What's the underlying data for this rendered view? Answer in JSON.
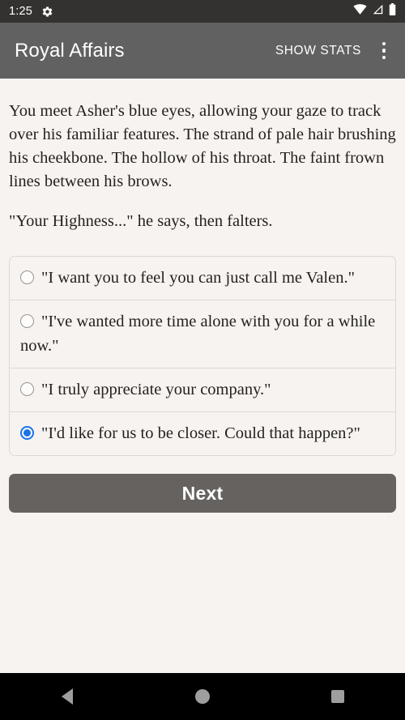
{
  "status_bar": {
    "clock": "1:25",
    "gear_icon": "gear-icon",
    "wifi_icon": "wifi-icon",
    "signal_icon": "cell-signal-icon",
    "battery_icon": "battery-full-icon"
  },
  "app_bar": {
    "title": "Royal Affairs",
    "action_label": "SHOW STATS",
    "overflow_icon": "more-vert-icon",
    "background_color": "#616161"
  },
  "story": {
    "paragraphs": [
      "You meet Asher's blue eyes, allowing your gaze to track over his familiar features. The strand of pale hair brushing his cheekbone. The hollow of his throat. The faint frown lines between his brows.",
      "\"Your Highness...\" he says, then falters."
    ]
  },
  "choices": {
    "selected_index": 3,
    "selected_color": "#1a73e8",
    "options": [
      {
        "label": "\"I want you to feel you can just call me Valen.\"",
        "selected": false
      },
      {
        "label": "\"I've wanted more time alone with you for a while now.\"",
        "selected": false
      },
      {
        "label": "\"I truly appreciate your company.\"",
        "selected": false
      },
      {
        "label": "\"I'd like for us to be closer. Could that happen?\"",
        "selected": true
      }
    ]
  },
  "next_button": {
    "label": "Next",
    "background_color": "#666260"
  },
  "nav_bar": {
    "back_icon": "back-triangle-icon",
    "home_icon": "home-circle-icon",
    "recents_icon": "recents-square-icon"
  },
  "theme": {
    "page_background": "#f7f3f0",
    "text_color": "#24221f",
    "border_color": "#ddd8d4"
  }
}
